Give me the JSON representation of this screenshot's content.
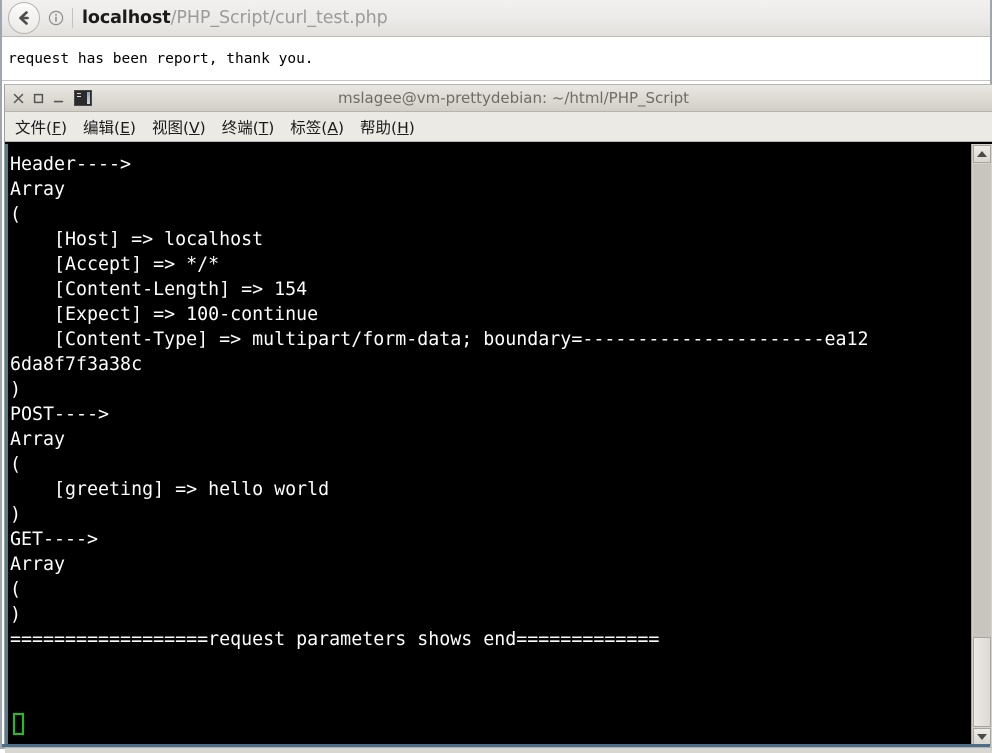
{
  "browser": {
    "back_button_label": "Back",
    "back_icon": "arrow-left-circle-icon",
    "site_info_icon": "info-circle-icon",
    "url_host": "localhost",
    "url_path": "/PHP_Script/curl_test.php",
    "url_full": "localhost/PHP_Script/curl_test.php"
  },
  "page": {
    "body_text": "request has been report, thank you."
  },
  "terminal": {
    "title": "mslagee@vm-prettydebian: ~/html/PHP_Script",
    "window_controls": [
      {
        "name": "close",
        "glyph": "✕"
      },
      {
        "name": "maximize",
        "glyph": "□"
      },
      {
        "name": "minimize",
        "glyph": "_"
      }
    ],
    "app_icon": "terminal-icon",
    "menu": [
      {
        "label": "文件(F)",
        "text_before": "文件(",
        "accel": "F",
        "text_after": ")"
      },
      {
        "label": "编辑(E)",
        "text_before": "编辑(",
        "accel": "E",
        "text_after": ")"
      },
      {
        "label": "视图(V)",
        "text_before": "视图(",
        "accel": "V",
        "text_after": ")"
      },
      {
        "label": "终端(T)",
        "text_before": "终端(",
        "accel": "T",
        "text_after": ")"
      },
      {
        "label": "标签(A)",
        "text_before": "标签(",
        "accel": "A",
        "text_after": ")"
      },
      {
        "label": "帮助(H)",
        "text_before": "帮助(",
        "accel": "H",
        "text_after": ")"
      }
    ],
    "output": "Header---->\nArray\n(\n    [Host] => localhost\n    [Accept] => */*\n    [Content-Length] => 154\n    [Expect] => 100-continue\n    [Content-Type] => multipart/form-data; boundary=----------------------ea12\n6da8f7f3a38c\n)\nPOST---->\nArray\n(\n    [greeting] => hello world\n)\nGET---->\nArray\n(\n)\n==================request parameters shows end=============",
    "cursor": "block-cursor",
    "scrollbar": {
      "up_arrow": "scroll-up-arrow",
      "down_arrow": "scroll-down-arrow"
    }
  },
  "colors": {
    "terminal_bg": "#000000",
    "terminal_fg": "#ffffff",
    "cursor_green": "#18c418",
    "left_edge_blue": "#5a7c8c",
    "chrome_gray": "#d8d6d1"
  }
}
